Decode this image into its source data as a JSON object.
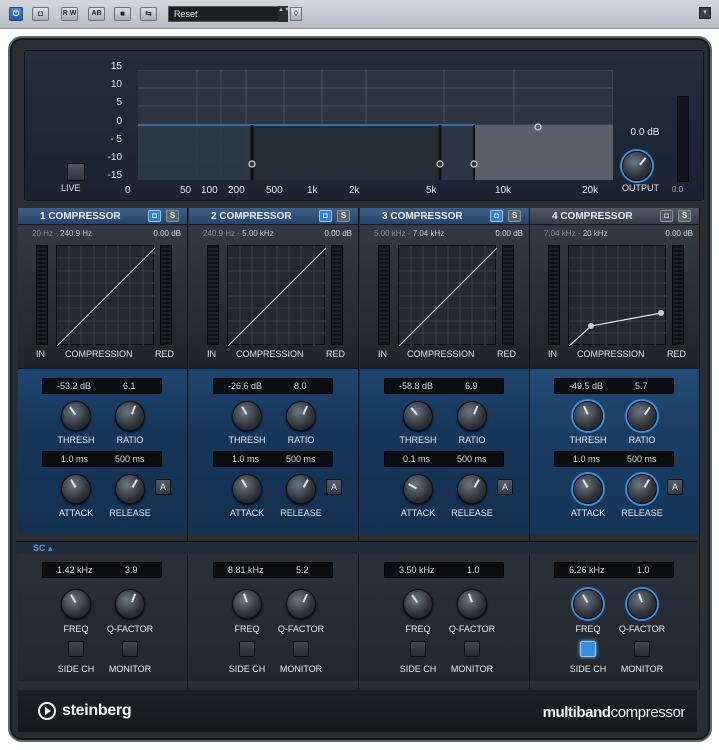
{
  "toolbar": {
    "power_icon": "power-icon",
    "btn_2": "◘",
    "read_write": "R W",
    "ab": "AB",
    "btn_5": "■",
    "btn_6": "⇆",
    "preset": "Reset",
    "preset_arrows": "▲▼",
    "preset_menu": "◊",
    "right_btn": "▾"
  },
  "display": {
    "db_ticks": [
      "15",
      "10",
      "5",
      "0",
      "- 5",
      "-10",
      "-15"
    ],
    "hz_ticks": [
      "0",
      "50",
      "100",
      "200",
      "500",
      "1k",
      "2k",
      "5k",
      "10k",
      "20k"
    ],
    "live_label": "LIVE",
    "output_value": "0.0 dB",
    "output_label": "OUTPUT",
    "meter_value": "0.0"
  },
  "bands": [
    {
      "title": "1  COMPRESSOR",
      "bypass": "◘",
      "solo": "S",
      "freq_low": "20 Hz",
      "freq_sep": " - ",
      "freq_high": "240.9 Hz",
      "gain": "0.00 dB",
      "in": "IN",
      "comp": "COMPRESSION",
      "red": "RED",
      "thresh_val": "-53.2 dB",
      "ratio_val": "6.1",
      "thresh": "THRESH",
      "ratio": "RATIO",
      "attack_val": "1.0 ms",
      "release_val": "500 ms",
      "attack": "ATTACK",
      "release": "RELEASE",
      "auto": "A",
      "sc_freq_val": "1.42 kHz",
      "sc_q_val": "3.9",
      "freq": "FREQ",
      "qfactor": "Q-FACTOR",
      "sidech": "SIDE CH",
      "monitor": "MONITOR"
    },
    {
      "title": "2  COMPRESSOR",
      "bypass": "◘",
      "solo": "S",
      "freq_low": "240.9 Hz",
      "freq_sep": " - ",
      "freq_high": "5.00 kHz",
      "gain": "0.00 dB",
      "in": "IN",
      "comp": "COMPRESSION",
      "red": "RED",
      "thresh_val": "-26.6 dB",
      "ratio_val": "8.0",
      "thresh": "THRESH",
      "ratio": "RATIO",
      "attack_val": "1.0 ms",
      "release_val": "500 ms",
      "attack": "ATTACK",
      "release": "RELEASE",
      "auto": "A",
      "sc_freq_val": "8.81 kHz",
      "sc_q_val": "5.2",
      "freq": "FREQ",
      "qfactor": "Q-FACTOR",
      "sidech": "SIDE CH",
      "monitor": "MONITOR"
    },
    {
      "title": "3  COMPRESSOR",
      "bypass": "◘",
      "solo": "S",
      "freq_low": "5.00 kHz",
      "freq_sep": " - ",
      "freq_high": "7.04 kHz",
      "gain": "0.00 dB",
      "in": "IN",
      "comp": "COMPRESSION",
      "red": "RED",
      "thresh_val": "-58.8 dB",
      "ratio_val": "6.9",
      "thresh": "THRESH",
      "ratio": "RATIO",
      "attack_val": "0.1 ms",
      "release_val": "500 ms",
      "attack": "ATTACK",
      "release": "RELEASE",
      "auto": "A",
      "sc_freq_val": "3.50 kHz",
      "sc_q_val": "1.0",
      "freq": "FREQ",
      "qfactor": "Q-FACTOR",
      "sidech": "SIDE CH",
      "monitor": "MONITOR"
    },
    {
      "title": "4  COMPRESSOR",
      "bypass": "◘",
      "solo": "S",
      "freq_low": "7.04 kHz",
      "freq_sep": " - ",
      "freq_high": "20 kHz",
      "gain": "0.00 dB",
      "in": "IN",
      "comp": "COMPRESSION",
      "red": "RED",
      "thresh_val": "-49.5 dB",
      "ratio_val": "5.7",
      "thresh": "THRESH",
      "ratio": "RATIO",
      "attack_val": "1.0 ms",
      "release_val": "500 ms",
      "attack": "ATTACK",
      "release": "RELEASE",
      "auto": "A",
      "sc_freq_val": "6.26 kHz",
      "sc_q_val": "1.0",
      "freq": "FREQ",
      "qfactor": "Q-FACTOR",
      "sidech": "SIDE CH",
      "monitor": "MONITOR"
    }
  ],
  "sc_label": "SC ▴",
  "footer": {
    "brand": "steinberg",
    "product_bold": "multiband",
    "product_rest": "compressor"
  },
  "colors": {
    "accent": "#2f7fd6",
    "param_panel": "#173a5f",
    "background": "#24282d"
  }
}
